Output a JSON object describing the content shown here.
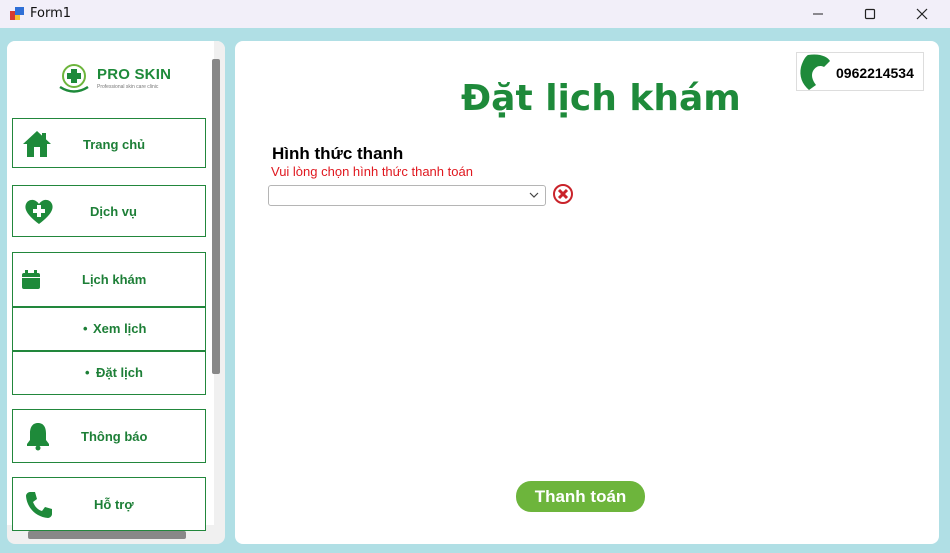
{
  "window": {
    "title": "Form1"
  },
  "logo": {
    "name": "PRO SKIN",
    "tagline": "Professional skin care clinic"
  },
  "sidebar": {
    "items": [
      {
        "label": "Trang chủ",
        "icon": "home-icon"
      },
      {
        "label": "Dịch vụ",
        "icon": "heart-plus-icon"
      },
      {
        "label": "Lịch khám",
        "icon": "calendar-icon"
      },
      {
        "label": "Xem lịch",
        "icon": "bullet"
      },
      {
        "label": "Đặt lịch",
        "icon": "bullet"
      },
      {
        "label": "Thông báo",
        "icon": "bell-icon"
      },
      {
        "label": "Hỗ trợ",
        "icon": "phone-icon"
      }
    ]
  },
  "hotline": {
    "number": "0962214534"
  },
  "main": {
    "title": "Đặt lịch khám",
    "payment_label": "Hình thức thanh",
    "error": "Vui lòng chọn hình thức thanh toán",
    "payment_select": {
      "value": ""
    },
    "submit_label": "Thanh toán"
  },
  "colors": {
    "brand_green": "#1e8a3a",
    "button_green": "#6db53c",
    "error_red": "#e0181f",
    "background": "#b0dfe5"
  }
}
